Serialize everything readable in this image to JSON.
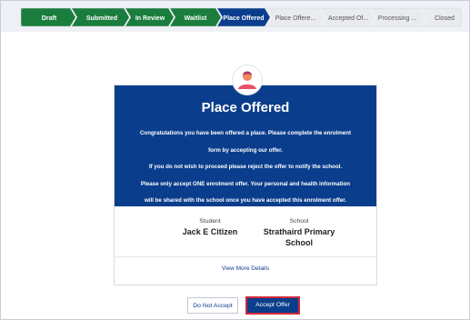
{
  "steps": [
    {
      "label": "Draft",
      "state": "done"
    },
    {
      "label": "Submitted",
      "state": "done"
    },
    {
      "label": "In Review",
      "state": "done"
    },
    {
      "label": "Waitlist",
      "state": "done"
    },
    {
      "label": "Place Offered",
      "state": "current"
    },
    {
      "label": "Place Offere...",
      "state": "pending"
    },
    {
      "label": "Accepted Of...",
      "state": "pending"
    },
    {
      "label": "Processing ...",
      "state": "pending"
    },
    {
      "label": "Closed",
      "state": "pending"
    }
  ],
  "card": {
    "title": "Place Offered",
    "message_lines": [
      "Congratulations you have been offered a place. Please complete the enrolment",
      "form by accepting our offer.",
      "If you do not wish to proceed please reject the offer to notify the school.",
      "Please only accept ONE enrolment offer. Your personal and health information",
      "will be shared with the school once you have accepted this enrolment offer."
    ],
    "student_label": "Student",
    "student_value": "Jack E Citizen",
    "school_label": "School",
    "school_value_line1": "Strathaird Primary",
    "school_value_line2": "School",
    "view_more": "View More Details"
  },
  "actions": {
    "reject_label": "Do Not Accept",
    "accept_label": "Accept Offer"
  },
  "colors": {
    "done": "#1a7d3d",
    "current": "#0a3e8c",
    "pending": "#e9ebef",
    "accent": "#0a3e8c",
    "highlight": "#d1283a"
  }
}
